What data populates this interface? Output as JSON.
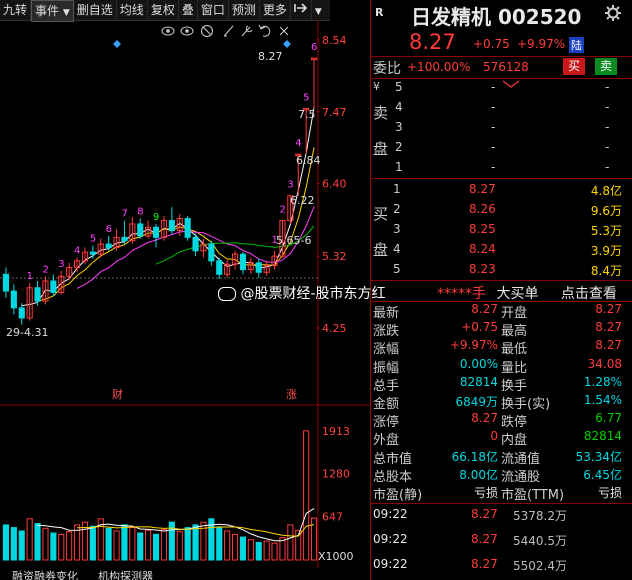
{
  "toolbar": {
    "items": [
      "九转",
      "事件",
      "删自选",
      "均线",
      "复权",
      "叠",
      "窗口",
      "预测",
      "更多"
    ],
    "dropdown_marker": "▼"
  },
  "stock": {
    "name": "日发精机",
    "code": "002520",
    "price": "8.27",
    "change": "+0.75",
    "change_pct": "+9.97%",
    "market_badge": "陆",
    "wb_label": "委比",
    "wb_value": "+100.00%",
    "wb_diff": "576128",
    "buy_label": "买",
    "sell_label": "卖"
  },
  "orderbook": {
    "sell_side_label": [
      "卖",
      "盘"
    ],
    "buy_side_label": [
      "买",
      "盘"
    ],
    "currency": "¥",
    "sell": [
      {
        "level": "5",
        "price": "-",
        "vol": "-"
      },
      {
        "level": "4",
        "price": "-",
        "vol": "-"
      },
      {
        "level": "3",
        "price": "-",
        "vol": "-"
      },
      {
        "level": "2",
        "price": "-",
        "vol": "-"
      },
      {
        "level": "1",
        "price": "-",
        "vol": "-"
      }
    ],
    "buy": [
      {
        "level": "1",
        "price": "8.27",
        "vol": "4.8亿"
      },
      {
        "level": "2",
        "price": "8.26",
        "vol": "9.6万"
      },
      {
        "level": "3",
        "price": "8.25",
        "vol": "5.3万"
      },
      {
        "level": "4",
        "price": "8.24",
        "vol": "3.9万"
      },
      {
        "level": "5",
        "price": "8.23",
        "vol": "8.4万"
      }
    ]
  },
  "bigorder": {
    "masked": "*****手",
    "label": "大买单",
    "link": "点击查看"
  },
  "watermark": "@股票财经-股市东方红",
  "quotes": [
    {
      "l1": "最新",
      "v1": "8.27",
      "c1": "red",
      "l2": "开盘",
      "v2": "8.27",
      "c2": "red"
    },
    {
      "l1": "涨跌",
      "v1": "+0.75",
      "c1": "red",
      "l2": "最高",
      "v2": "8.27",
      "c2": "red"
    },
    {
      "l1": "涨幅",
      "v1": "+9.97%",
      "c1": "red",
      "l2": "最低",
      "v2": "8.27",
      "c2": "red"
    },
    {
      "l1": "振幅",
      "v1": "0.00%",
      "c1": "cyan",
      "l2": "量比",
      "v2": "34.08",
      "c2": "red"
    },
    {
      "l1": "总手",
      "v1": "82814",
      "c1": "cyan",
      "l2": "换手",
      "v2": "1.28%",
      "c2": "cyan"
    },
    {
      "l1": "金额",
      "v1": "6849万",
      "c1": "cyan",
      "l2": "换手(实)",
      "v2": "1.54%",
      "c2": "cyan"
    },
    {
      "l1": "涨停",
      "v1": "8.27",
      "c1": "red",
      "l2": "跌停",
      "v2": "6.77",
      "c2": "green"
    },
    {
      "l1": "外盘",
      "v1": "0",
      "c1": "red",
      "l2": "内盘",
      "v2": "82814",
      "c2": "green"
    },
    {
      "l1": "总市值",
      "v1": "66.18亿",
      "c1": "cyan",
      "l2": "流通值",
      "v2": "53.34亿",
      "c2": "cyan"
    },
    {
      "l1": "总股本",
      "v1": "8.00亿",
      "c1": "cyan",
      "l2": "流通股",
      "v2": "6.45亿",
      "c2": "cyan"
    },
    {
      "l1": "市盈(静)",
      "v1": "亏损",
      "c1": "white",
      "l2": "市盈(TTM)",
      "v2": "亏损",
      "c2": "white"
    }
  ],
  "ticks": [
    {
      "time": "09:22",
      "price": "8.27",
      "vol": "5378.2万"
    },
    {
      "time": "09:22",
      "price": "8.27",
      "vol": "5440.5万"
    },
    {
      "time": "09:22",
      "price": "8.27",
      "vol": "5502.4万"
    }
  ],
  "chart": {
    "price_ticks": [
      "8.54",
      "7.47",
      "6.40",
      "5.32",
      "4.25"
    ],
    "vol_ticks": [
      "1913",
      "1280",
      "647"
    ],
    "vol_unit": "X1000",
    "range_label": "29-4.31",
    "high_label": "8.27",
    "label_limit": "7.5",
    "label_684": "6.84",
    "label_622": "6.22",
    "label_565": "5.65-6",
    "ev_cai": "财",
    "ev_zhang": "涨",
    "tabs": [
      "融资融券变化",
      "机构探测器"
    ],
    "seq_top": [
      "1",
      "2",
      "3",
      "4",
      "5",
      "6"
    ],
    "seq_left": [
      "1",
      "2",
      "3",
      "4",
      "5",
      "6",
      "7",
      "8",
      "9"
    ],
    "colors": {
      "up": "#ff3b3b",
      "down": "#00d8e0",
      "ma5": "#ffffff",
      "ma10": "#ffd400",
      "ma20": "#ff40ff",
      "ma60": "#00c000"
    }
  },
  "chart_data": {
    "type": "candlestick",
    "price_axis": [
      4.25,
      8.54
    ],
    "candles": [
      {
        "o": 5.05,
        "c": 4.8,
        "h": 5.15,
        "l": 4.7
      },
      {
        "o": 4.8,
        "c": 4.55,
        "h": 4.9,
        "l": 4.45
      },
      {
        "o": 4.55,
        "c": 4.4,
        "h": 4.62,
        "l": 4.3
      },
      {
        "o": 4.4,
        "c": 4.85,
        "h": 4.92,
        "l": 4.36
      },
      {
        "o": 4.85,
        "c": 4.65,
        "h": 4.95,
        "l": 4.58
      },
      {
        "o": 4.65,
        "c": 4.95,
        "h": 5.02,
        "l": 4.6
      },
      {
        "o": 4.95,
        "c": 4.78,
        "h": 5.05,
        "l": 4.72
      },
      {
        "o": 4.78,
        "c": 5.02,
        "h": 5.1,
        "l": 4.75
      },
      {
        "o": 5.02,
        "c": 5.15,
        "h": 5.22,
        "l": 4.96
      },
      {
        "o": 5.15,
        "c": 5.25,
        "h": 5.3,
        "l": 5.08
      },
      {
        "o": 5.25,
        "c": 5.38,
        "h": 5.45,
        "l": 5.2
      },
      {
        "o": 5.38,
        "c": 5.35,
        "h": 5.48,
        "l": 5.28
      },
      {
        "o": 5.35,
        "c": 5.5,
        "h": 5.58,
        "l": 5.3
      },
      {
        "o": 5.5,
        "c": 5.45,
        "h": 5.62,
        "l": 5.4
      },
      {
        "o": 5.45,
        "c": 5.6,
        "h": 5.72,
        "l": 5.4
      },
      {
        "o": 5.6,
        "c": 5.55,
        "h": 5.85,
        "l": 5.5
      },
      {
        "o": 5.55,
        "c": 5.8,
        "h": 5.9,
        "l": 5.5
      },
      {
        "o": 5.8,
        "c": 5.62,
        "h": 5.88,
        "l": 5.58
      },
      {
        "o": 5.62,
        "c": 5.75,
        "h": 5.85,
        "l": 5.58
      },
      {
        "o": 5.75,
        "c": 5.6,
        "h": 5.8,
        "l": 5.45
      },
      {
        "o": 5.6,
        "c": 5.85,
        "h": 5.92,
        "l": 5.55
      },
      {
        "o": 5.85,
        "c": 5.7,
        "h": 6.05,
        "l": 5.65
      },
      {
        "o": 5.7,
        "c": 5.88,
        "h": 5.95,
        "l": 5.62
      },
      {
        "o": 5.88,
        "c": 5.6,
        "h": 5.92,
        "l": 5.55
      },
      {
        "o": 5.6,
        "c": 5.4,
        "h": 5.66,
        "l": 5.32
      },
      {
        "o": 5.4,
        "c": 5.5,
        "h": 5.58,
        "l": 5.3
      },
      {
        "o": 5.5,
        "c": 5.25,
        "h": 5.55,
        "l": 5.18
      },
      {
        "o": 5.25,
        "c": 5.05,
        "h": 5.3,
        "l": 4.98
      },
      {
        "o": 5.05,
        "c": 5.2,
        "h": 5.28,
        "l": 5.0
      },
      {
        "o": 5.2,
        "c": 5.35,
        "h": 5.4,
        "l": 5.12
      },
      {
        "o": 5.35,
        "c": 5.12,
        "h": 5.38,
        "l": 5.05
      },
      {
        "o": 5.12,
        "c": 5.22,
        "h": 5.3,
        "l": 5.05
      },
      {
        "o": 5.22,
        "c": 5.08,
        "h": 5.28,
        "l": 5.0
      },
      {
        "o": 5.08,
        "c": 5.18,
        "h": 5.25,
        "l": 5.02
      },
      {
        "o": 5.18,
        "c": 5.32,
        "h": 5.4,
        "l": 5.12
      },
      {
        "o": 5.32,
        "c": 5.85,
        "h": 5.85,
        "l": 5.3
      },
      {
        "o": 5.85,
        "c": 6.22,
        "h": 6.22,
        "l": 5.8
      },
      {
        "o": 6.84,
        "c": 6.84,
        "h": 6.84,
        "l": 6.22
      },
      {
        "o": 7.52,
        "c": 7.52,
        "h": 7.52,
        "l": 6.84
      },
      {
        "o": 8.27,
        "c": 8.27,
        "h": 8.27,
        "l": 7.52
      }
    ],
    "volumes": [
      520,
      480,
      430,
      610,
      540,
      470,
      400,
      380,
      420,
      520,
      560,
      500,
      610,
      470,
      430,
      520,
      480,
      400,
      440,
      380,
      450,
      560,
      420,
      480,
      520,
      560,
      610,
      480,
      430,
      380,
      340,
      300,
      260,
      280,
      250,
      330,
      520,
      440,
      1913,
      620
    ],
    "vol_axis": [
      0,
      2000
    ]
  }
}
